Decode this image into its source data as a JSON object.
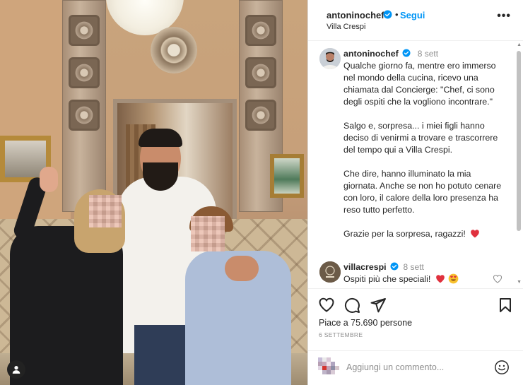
{
  "post": {
    "author": "antoninochef",
    "follow_label": "Segui",
    "location": "Villa Crespi",
    "more_label": "•••"
  },
  "caption": {
    "author": "antoninochef",
    "time": "8 sett",
    "paragraphs": [
      "Qualche giorno fa, mentre ero immerso nel mondo della cucina, ricevo una chiamata dal Concierge: \"Chef, ci sono degli ospiti che la vogliono incontrare.\"",
      "Salgo e, sorpresa... i miei figli hanno deciso di venirmi a trovare e trascorrere del tempo qui a Villa Crespi.",
      "Che dire, hanno illuminato la mia giornata. Anche se non ho potuto cenare con loro, il calore della loro presenza ha reso tutto perfetto.",
      "Grazie per la sorpresa, ragazzi!"
    ]
  },
  "comment": {
    "author": "villacrespi",
    "time": "8 sett",
    "text": "Ospiti più che speciali!"
  },
  "stats": {
    "likes": "Piace a 75.690 persone",
    "date": "6 SETTEMBRE"
  },
  "add_comment": {
    "placeholder": "Aggiungi un commento..."
  },
  "colors": {
    "accent": "#0095f6",
    "verified": "#0095f6",
    "heart": "#ed4956"
  }
}
